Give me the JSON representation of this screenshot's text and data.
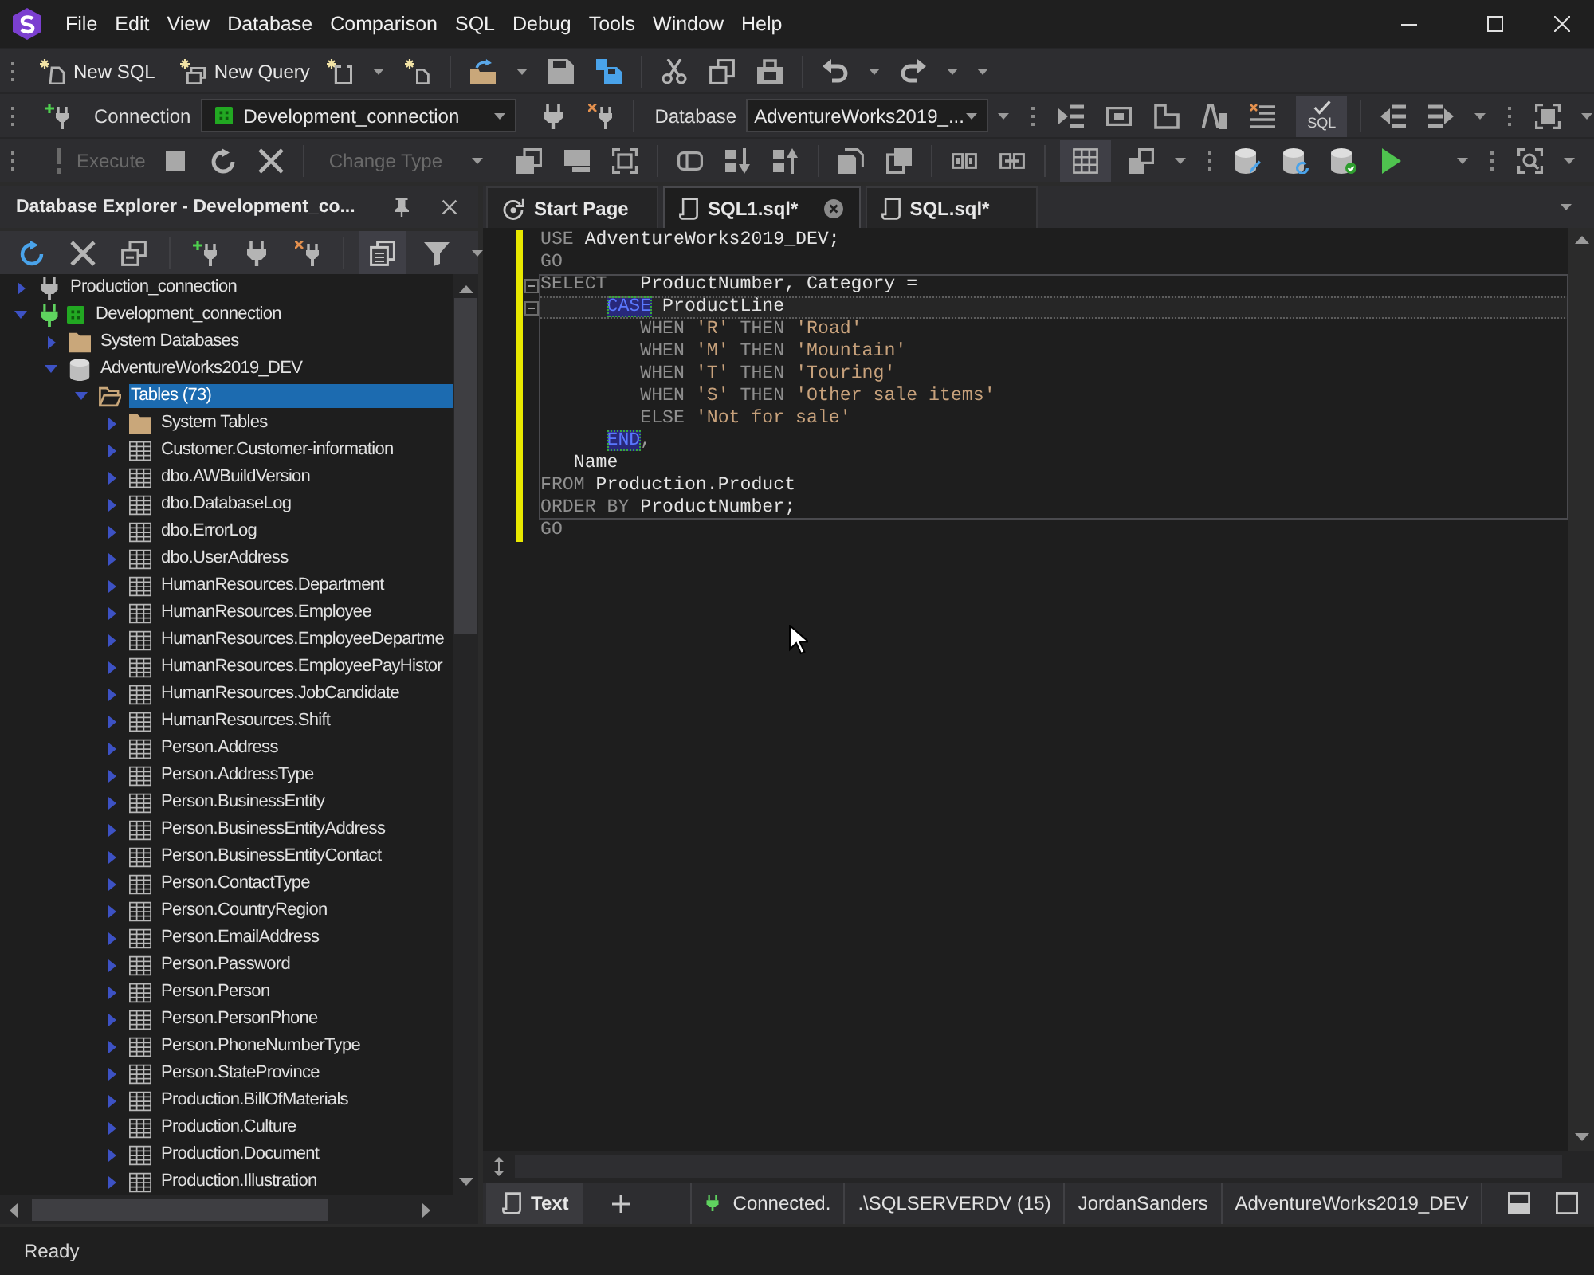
{
  "menu_bar": {
    "items": [
      "File",
      "Edit",
      "View",
      "Database",
      "Comparison",
      "SQL",
      "Debug",
      "Tools",
      "Window",
      "Help"
    ]
  },
  "standard_toolbar": {
    "new_sql": "New SQL",
    "new_query": "New Query"
  },
  "connection_toolbar": {
    "connection_label": "Connection",
    "connection": {
      "value": "Development_connection",
      "category_badge": true
    },
    "database_label": "Database",
    "database": {
      "value": "AdventureWorks2019_..."
    },
    "sql_toggle": {
      "label": "SQL",
      "pressed": true
    }
  },
  "execute_toolbar": {
    "execute": {
      "label": "Execute",
      "disabled": true
    },
    "change_type": {
      "label": "Change Type",
      "disabled": true
    },
    "grid_toggle": {
      "pressed": true
    }
  },
  "explorer": {
    "title": "Database Explorer - Development_co...",
    "group_toggle": {
      "pressed": true
    },
    "tree": [
      {
        "label": "Production_connection",
        "kind": "connection",
        "connected": false,
        "category_badge": false,
        "expanded": false,
        "selected": false
      },
      {
        "label": "Development_connection",
        "kind": "connection",
        "connected": true,
        "category_badge": true,
        "expanded": true,
        "selected": false,
        "children": [
          {
            "label": "System Databases",
            "kind": "folder",
            "expanded": false,
            "selected": false
          },
          {
            "label": "AdventureWorks2019_DEV",
            "kind": "database",
            "expanded": true,
            "selected": false,
            "children": [
              {
                "label": "Tables (73)",
                "kind": "folder",
                "expanded": true,
                "selected": true,
                "children": [
                  {
                    "label": "System Tables",
                    "kind": "folder",
                    "expanded": false,
                    "selected": false
                  },
                  {
                    "label": "Customer.Customer-information",
                    "kind": "table",
                    "expanded": false,
                    "selected": false
                  },
                  {
                    "label": "dbo.AWBuildVersion",
                    "kind": "table",
                    "expanded": false,
                    "selected": false
                  },
                  {
                    "label": "dbo.DatabaseLog",
                    "kind": "table",
                    "expanded": false,
                    "selected": false
                  },
                  {
                    "label": "dbo.ErrorLog",
                    "kind": "table",
                    "expanded": false,
                    "selected": false
                  },
                  {
                    "label": "dbo.UserAddress",
                    "kind": "table",
                    "expanded": false,
                    "selected": false
                  },
                  {
                    "label": "HumanResources.Department",
                    "kind": "table",
                    "expanded": false,
                    "selected": false
                  },
                  {
                    "label": "HumanResources.Employee",
                    "kind": "table",
                    "expanded": false,
                    "selected": false
                  },
                  {
                    "label": "HumanResources.EmployeeDepartme",
                    "kind": "table",
                    "expanded": false,
                    "selected": false
                  },
                  {
                    "label": "HumanResources.EmployeePayHistor",
                    "kind": "table",
                    "expanded": false,
                    "selected": false
                  },
                  {
                    "label": "HumanResources.JobCandidate",
                    "kind": "table",
                    "expanded": false,
                    "selected": false
                  },
                  {
                    "label": "HumanResources.Shift",
                    "kind": "table",
                    "expanded": false,
                    "selected": false
                  },
                  {
                    "label": "Person.Address",
                    "kind": "table",
                    "expanded": false,
                    "selected": false
                  },
                  {
                    "label": "Person.AddressType",
                    "kind": "table",
                    "expanded": false,
                    "selected": false
                  },
                  {
                    "label": "Person.BusinessEntity",
                    "kind": "table",
                    "expanded": false,
                    "selected": false
                  },
                  {
                    "label": "Person.BusinessEntityAddress",
                    "kind": "table",
                    "expanded": false,
                    "selected": false
                  },
                  {
                    "label": "Person.BusinessEntityContact",
                    "kind": "table",
                    "expanded": false,
                    "selected": false
                  },
                  {
                    "label": "Person.ContactType",
                    "kind": "table",
                    "expanded": false,
                    "selected": false
                  },
                  {
                    "label": "Person.CountryRegion",
                    "kind": "table",
                    "expanded": false,
                    "selected": false
                  },
                  {
                    "label": "Person.EmailAddress",
                    "kind": "table",
                    "expanded": false,
                    "selected": false
                  },
                  {
                    "label": "Person.Password",
                    "kind": "table",
                    "expanded": false,
                    "selected": false
                  },
                  {
                    "label": "Person.Person",
                    "kind": "table",
                    "expanded": false,
                    "selected": false
                  },
                  {
                    "label": "Person.PersonPhone",
                    "kind": "table",
                    "expanded": false,
                    "selected": false
                  },
                  {
                    "label": "Person.PhoneNumberType",
                    "kind": "table",
                    "expanded": false,
                    "selected": false
                  },
                  {
                    "label": "Person.StateProvince",
                    "kind": "table",
                    "expanded": false,
                    "selected": false
                  },
                  {
                    "label": "Production.BillOfMaterials",
                    "kind": "table",
                    "expanded": false,
                    "selected": false
                  },
                  {
                    "label": "Production.Culture",
                    "kind": "table",
                    "expanded": false,
                    "selected": false
                  },
                  {
                    "label": "Production.Document",
                    "kind": "table",
                    "expanded": false,
                    "selected": false
                  },
                  {
                    "label": "Production.Illustration",
                    "kind": "table",
                    "expanded": false,
                    "selected": false
                  }
                ]
              }
            ]
          }
        ]
      }
    ]
  },
  "editor": {
    "tabs": [
      {
        "label": "Start Page",
        "kind": "start",
        "selected": false
      },
      {
        "label": "SQL1.sql*",
        "kind": "sql",
        "selected": true
      },
      {
        "label": "SQL.sql*",
        "kind": "sql",
        "selected": false
      }
    ],
    "blocks": [
      {
        "kind": "plain",
        "lines": [
          {
            "tokens": [
              {
                "text": "USE",
                "kind": "keyword"
              },
              {
                "text": " AdventureWorks2019_DEV;",
                "kind": "identifier"
              }
            ],
            "modified": true,
            "current": false,
            "fold": false
          },
          {
            "tokens": [
              {
                "text": "GO",
                "kind": "keyword"
              }
            ],
            "modified": true,
            "current": false,
            "fold": false
          }
        ]
      },
      {
        "kind": "statement",
        "lines": [
          {
            "tokens": [
              {
                "text": "SELECT",
                "kind": "keyword"
              },
              {
                "text": "   ProductNumber, Category =",
                "kind": "identifier"
              }
            ],
            "modified": true,
            "current": false,
            "fold": true
          },
          {
            "tokens": [
              {
                "text": "      CASE",
                "kind": "match"
              },
              {
                "text": " ProductLine",
                "kind": "identifier"
              }
            ],
            "modified": true,
            "current": true,
            "fold": true
          },
          {
            "tokens": [
              {
                "text": "         WHEN",
                "kind": "keyword"
              },
              {
                "text": " 'R'",
                "kind": "string"
              },
              {
                "text": " THEN",
                "kind": "keyword"
              },
              {
                "text": " 'Road'",
                "kind": "string"
              }
            ],
            "modified": true,
            "current": false,
            "fold": false
          },
          {
            "tokens": [
              {
                "text": "         WHEN",
                "kind": "keyword"
              },
              {
                "text": " 'M'",
                "kind": "string"
              },
              {
                "text": " THEN",
                "kind": "keyword"
              },
              {
                "text": " 'Mountain'",
                "kind": "string"
              }
            ],
            "modified": true,
            "current": false,
            "fold": false
          },
          {
            "tokens": [
              {
                "text": "         WHEN",
                "kind": "keyword"
              },
              {
                "text": " 'T'",
                "kind": "string"
              },
              {
                "text": " THEN",
                "kind": "keyword"
              },
              {
                "text": " 'Touring'",
                "kind": "string"
              }
            ],
            "modified": true,
            "current": false,
            "fold": false
          },
          {
            "tokens": [
              {
                "text": "         WHEN",
                "kind": "keyword"
              },
              {
                "text": " 'S'",
                "kind": "string"
              },
              {
                "text": " THEN",
                "kind": "keyword"
              },
              {
                "text": " 'Other sale items'",
                "kind": "string"
              }
            ],
            "modified": true,
            "current": false,
            "fold": false
          },
          {
            "tokens": [
              {
                "text": "         ELSE",
                "kind": "keyword"
              },
              {
                "text": " 'Not for sale'",
                "kind": "string"
              }
            ],
            "modified": true,
            "current": false,
            "fold": false
          },
          {
            "tokens": [
              {
                "text": "      END",
                "kind": "match"
              },
              {
                "text": ",",
                "kind": "punctuation"
              }
            ],
            "modified": true,
            "current": false,
            "fold": false
          },
          {
            "tokens": [
              {
                "text": "   Name",
                "kind": "identifier"
              }
            ],
            "modified": true,
            "current": false,
            "fold": false
          },
          {
            "tokens": [
              {
                "text": "FROM",
                "kind": "keyword"
              },
              {
                "text": " Production.Product",
                "kind": "identifier"
              }
            ],
            "modified": true,
            "current": false,
            "fold": false
          },
          {
            "tokens": [
              {
                "text": "ORDER BY",
                "kind": "keyword"
              },
              {
                "text": " ProductNumber;",
                "kind": "identifier"
              }
            ],
            "modified": true,
            "current": false,
            "fold": false
          }
        ]
      },
      {
        "kind": "plain",
        "lines": [
          {
            "tokens": [
              {
                "text": "GO",
                "kind": "keyword"
              }
            ],
            "modified": true,
            "current": false,
            "fold": false
          }
        ]
      }
    ]
  },
  "result_bar": {
    "tabs": [
      {
        "label": "Text",
        "selected": true
      }
    ],
    "connection": {
      "status": "Connected.",
      "connected": true
    },
    "server": ".\\SQLSERVERDV (15)",
    "user": "JordanSanders",
    "database": "AdventureWorks2019_DEV"
  },
  "status_bar": {
    "text": "Ready"
  }
}
